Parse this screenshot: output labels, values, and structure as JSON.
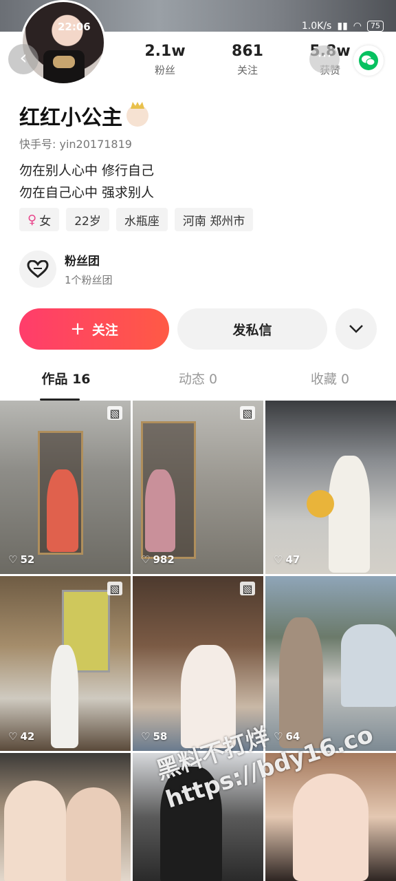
{
  "status_bar": {
    "time": "22:06",
    "net_speed": "1.0K/s",
    "battery": "75"
  },
  "profile": {
    "stats": [
      {
        "value": "2.1w",
        "label": "粉丝"
      },
      {
        "value": "861",
        "label": "关注"
      },
      {
        "value": "5.8w",
        "label": "获赞"
      }
    ],
    "name": "红红小公主",
    "user_id": "快手号: yin20171819",
    "bio": [
      "勿在别人心中 修行自己",
      "勿在自己心中 强求别人"
    ],
    "tags": [
      "女",
      "22岁",
      "水瓶座",
      "河南 郑州市"
    ],
    "fan_club": {
      "title": "粉丝团",
      "subtitle": "1个粉丝团"
    }
  },
  "actions": {
    "follow_label": "关注",
    "message_label": "发私信"
  },
  "tabs": [
    {
      "label": "作品 16",
      "active": true
    },
    {
      "label": "动态 0",
      "active": false
    },
    {
      "label": "收藏 0",
      "active": false
    }
  ],
  "posts": [
    {
      "likes": "52"
    },
    {
      "likes": "982"
    },
    {
      "likes": "47"
    },
    {
      "likes": "42"
    },
    {
      "likes": "58"
    },
    {
      "likes": "64"
    },
    {
      "likes": ""
    },
    {
      "likes": ""
    },
    {
      "likes": ""
    }
  ],
  "watermark": [
    "黑料不打烊",
    "https://bdy16.co"
  ],
  "colors": {
    "accent": "#ff4060",
    "wechat": "#07c160",
    "female": "#e8458b"
  }
}
